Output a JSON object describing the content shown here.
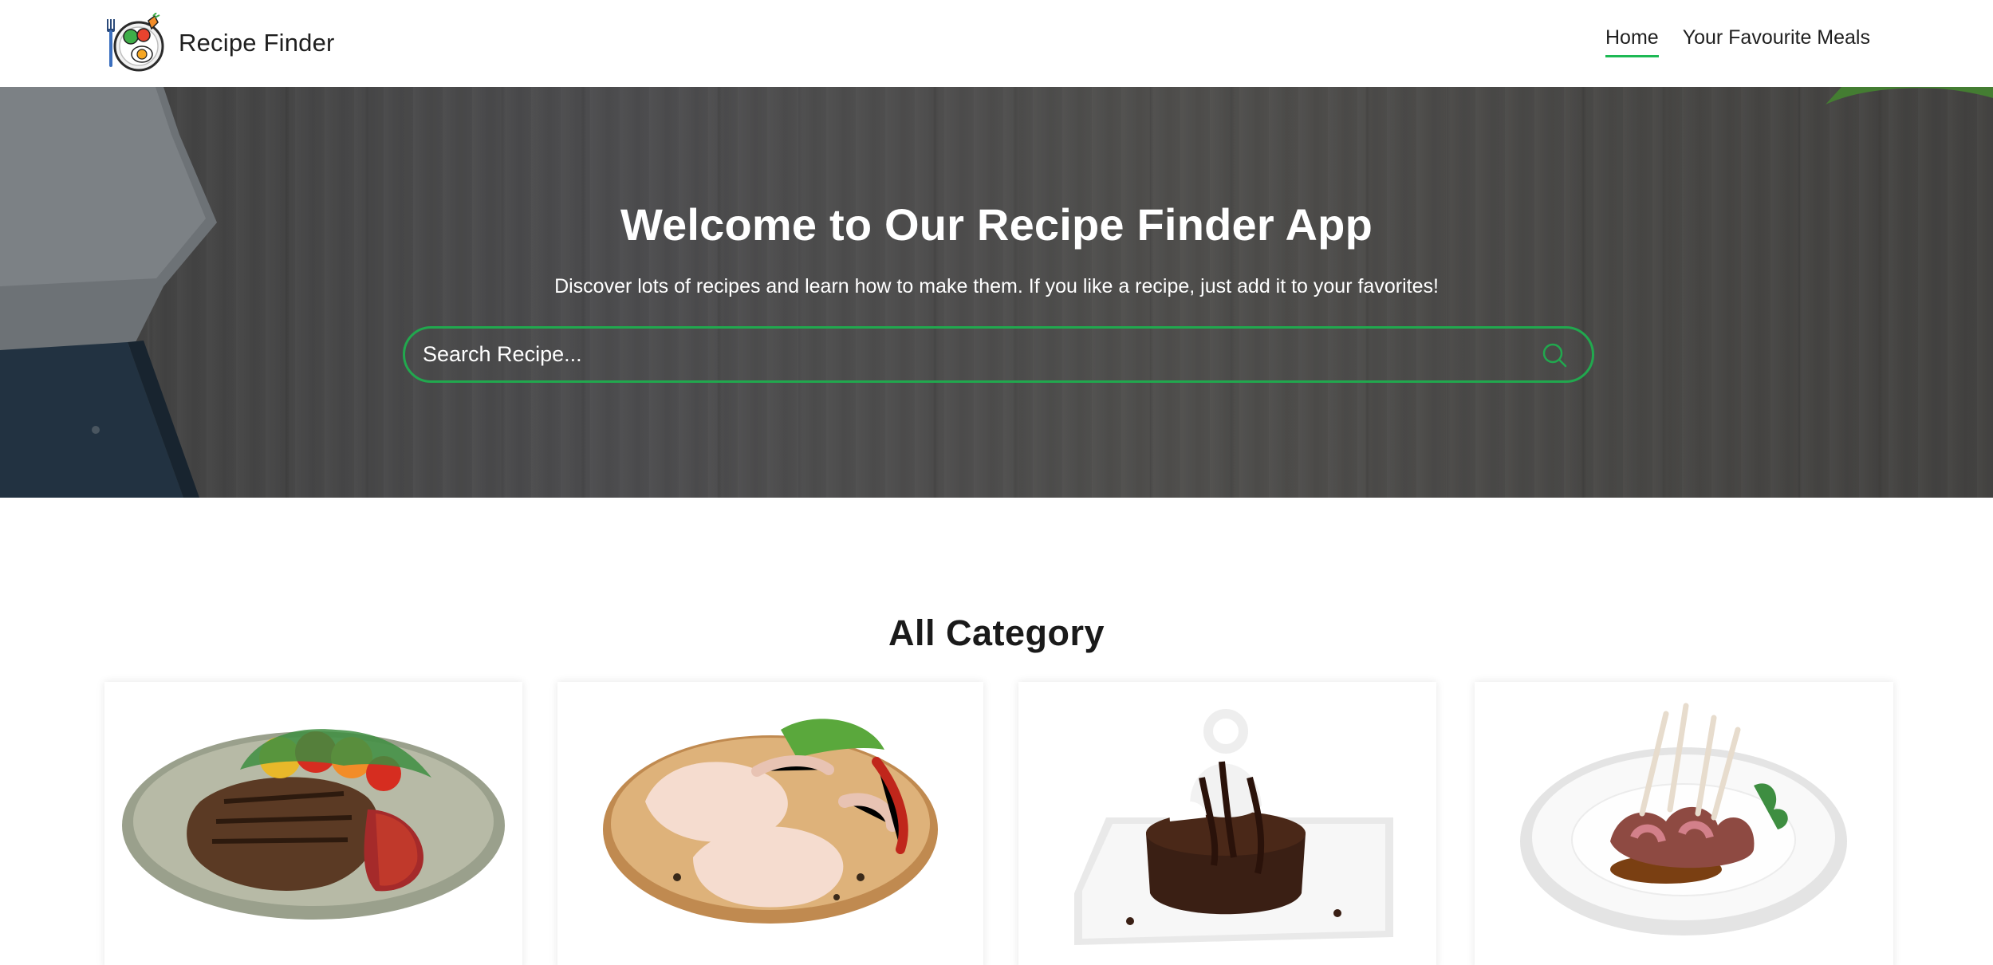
{
  "brand": {
    "name": "Recipe Finder",
    "logo_icon": "recipe-plate-logo-icon"
  },
  "nav": {
    "home_label": "Home",
    "favourites_label": "Your Favourite Meals",
    "active_underline_color": "#1db954"
  },
  "hero": {
    "title": "Welcome to Our Recipe Finder App",
    "subtitle": "Discover lots of recipes and learn how to make them. If you like a recipe, just add it to your favorites!",
    "search": {
      "placeholder": "Search Recipe...",
      "value": "",
      "icon": "search-icon",
      "border_color": "#21a84e"
    }
  },
  "categories": {
    "title": "All Category",
    "items": [
      {
        "image": "steak-plate"
      },
      {
        "image": "raw-chicken-board"
      },
      {
        "image": "chocolate-lava-cake"
      },
      {
        "image": "lamb-chops-plate"
      }
    ]
  }
}
